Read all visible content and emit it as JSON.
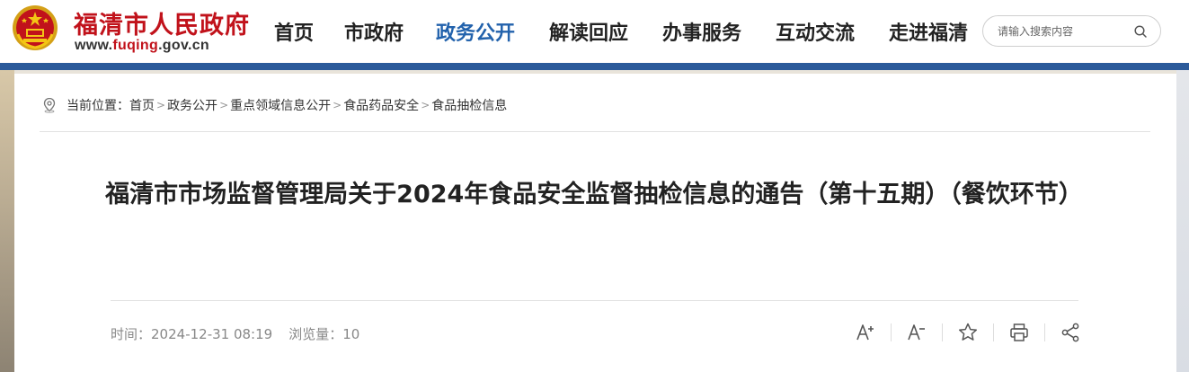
{
  "header": {
    "site_name": "福清市人民政府",
    "site_url_prefix": "www.",
    "site_url_accent": "fuqing",
    "site_url_suffix": ".gov.cn"
  },
  "nav": {
    "items": [
      {
        "label": "首页"
      },
      {
        "label": "市政府"
      },
      {
        "label": "政务公开"
      },
      {
        "label": "解读回应"
      },
      {
        "label": "办事服务"
      },
      {
        "label": "互动交流"
      },
      {
        "label": "走进福清"
      }
    ],
    "active_index": 2
  },
  "search": {
    "placeholder": "请输入搜索内容",
    "icon": "search-icon"
  },
  "breadcrumb": {
    "prefix": "当前位置：",
    "items": [
      {
        "label": "首页"
      },
      {
        "label": "政务公开"
      },
      {
        "label": "重点领域信息公开"
      },
      {
        "label": "食品药品安全"
      },
      {
        "label": "食品抽检信息"
      }
    ],
    "separator": ">"
  },
  "article": {
    "title": "福清市市场监督管理局关于2024年食品安全监督抽检信息的通告（第十五期）（餐饮环节）",
    "time_label": "时间：",
    "time_value": "2024-12-31 08:19",
    "views_label": "浏览量：",
    "views_value": "10"
  },
  "tools": [
    {
      "icon": "font-increase-icon"
    },
    {
      "icon": "font-decrease-icon"
    },
    {
      "icon": "star-icon"
    },
    {
      "icon": "print-icon"
    },
    {
      "icon": "share-icon"
    }
  ],
  "colors": {
    "brand_red": "#c1121b",
    "nav_active": "#2262ac",
    "blue_bar": "#2b5a9a"
  }
}
